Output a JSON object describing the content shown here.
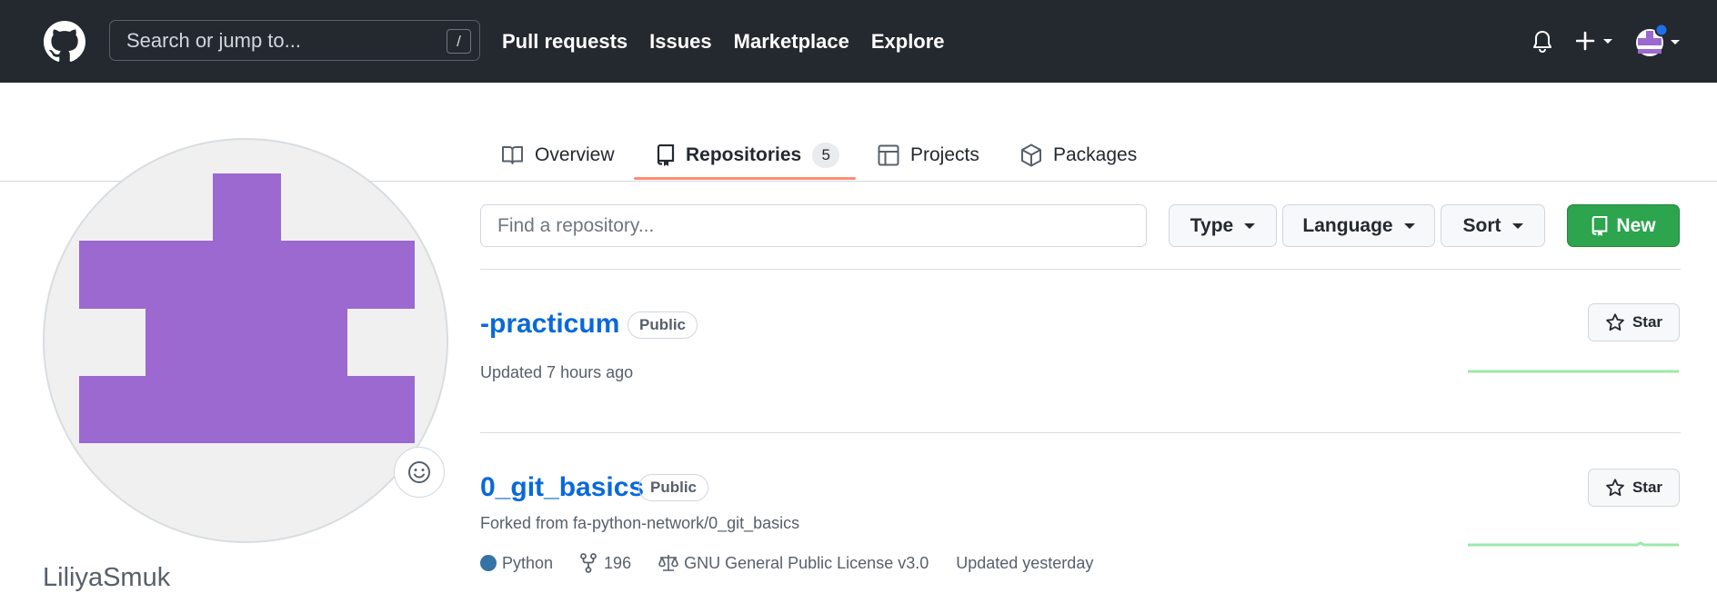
{
  "header": {
    "search_placeholder": "Search or jump to...",
    "search_hotkey": "/",
    "nav": [
      "Pull requests",
      "Issues",
      "Marketplace",
      "Explore"
    ]
  },
  "tabs": [
    {
      "label": "Overview",
      "icon": "book-icon"
    },
    {
      "label": "Repositories",
      "icon": "repo-icon",
      "count": "5",
      "active": true
    },
    {
      "label": "Projects",
      "icon": "table-icon"
    },
    {
      "label": "Packages",
      "icon": "package-icon"
    }
  ],
  "profile": {
    "username": "LiliyaSmuk",
    "avatar_color": "#9b69cf"
  },
  "filters": {
    "find_placeholder": "Find a repository...",
    "type_label": "Type",
    "language_label": "Language",
    "sort_label": "Sort",
    "new_label": "New"
  },
  "repos": [
    {
      "name": "-practicum",
      "visibility": "Public",
      "updated": "Updated 7 hours ago",
      "star_label": "Star"
    },
    {
      "name": "0_git_basics",
      "visibility": "Public",
      "forked_from": "Forked from fa-python-network/0_git_basics",
      "language": "Python",
      "language_color": "#3572a5",
      "forks": "196",
      "license": "GNU General Public License v3.0",
      "updated": "Updated yesterday",
      "star_label": "Star"
    }
  ],
  "colors": {
    "header_bg": "#24292f",
    "link": "#0969da",
    "new_button": "#2da44e",
    "tab_underline": "#fd8c73",
    "sparkline": "#9be9a8"
  }
}
